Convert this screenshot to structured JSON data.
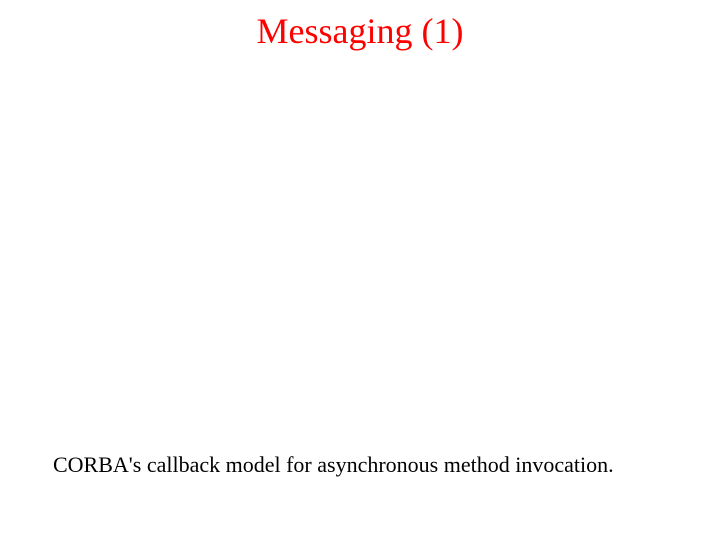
{
  "title": "Messaging (1)",
  "caption": "CORBA's callback model for asynchronous method invocation."
}
